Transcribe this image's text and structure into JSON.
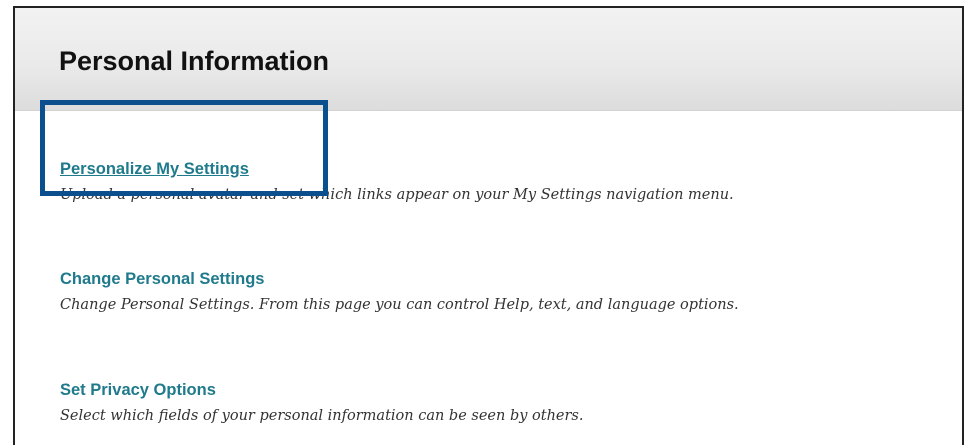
{
  "panel": {
    "title": "Personal Information"
  },
  "entries": [
    {
      "link": "Personalize My Settings",
      "description": "Upload a personal avatar and set which links appear on your My Settings navigation menu."
    },
    {
      "link": "Change Personal Settings",
      "description": "Change Personal Settings. From this page you can control Help, text, and language options."
    },
    {
      "link": "Set Privacy Options",
      "description": "Select which fields of your personal information can be seen by others."
    }
  ],
  "colors": {
    "link": "#1f7a8c",
    "highlight": "#0b4f8f",
    "title": "#111111",
    "description": "#333333"
  }
}
